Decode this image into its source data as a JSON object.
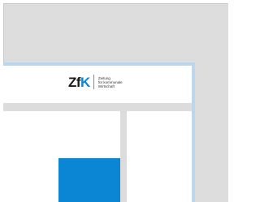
{
  "logo": {
    "mark_main": "Zf",
    "mark_accent": "K",
    "tagline_line1": "Zeitung",
    "tagline_line2": "für kommunale",
    "tagline_line3": "Wirtschaft"
  },
  "colors": {
    "accent_blue": "#0a86d4",
    "frame_blue": "#bcd6ee",
    "background_grey": "#dddddd"
  }
}
